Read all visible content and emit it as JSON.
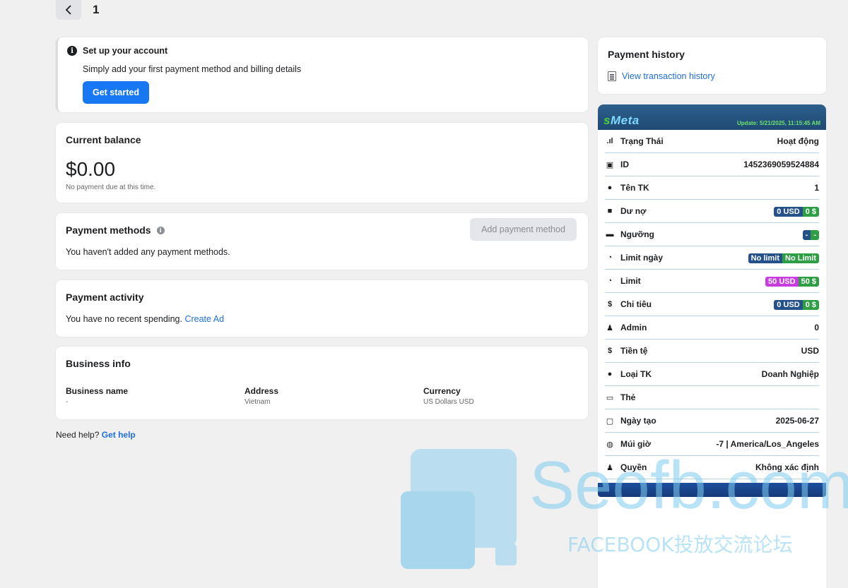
{
  "topbar": {
    "page": "1"
  },
  "setup": {
    "title": "Set up your account",
    "description": "Simply add your first payment method and billing details",
    "button": "Get started"
  },
  "balance": {
    "title": "Current balance",
    "amount": "$0.00",
    "note": "No payment due at this time."
  },
  "methods": {
    "title": "Payment methods",
    "button": "Add payment method",
    "empty": "You haven't added any payment methods."
  },
  "activity": {
    "title": "Payment activity",
    "text": "You have no recent spending.",
    "link": "Create Ad"
  },
  "business": {
    "title": "Business info",
    "columns": [
      {
        "label": "Business name",
        "value": "-"
      },
      {
        "label": "Address",
        "value": "Vietnam"
      },
      {
        "label": "Currency",
        "value": "US Dollars USD"
      }
    ]
  },
  "help": {
    "text": "Need help?",
    "link": "Get help"
  },
  "history": {
    "title": "Payment history",
    "link": "View transaction history"
  },
  "smeta": {
    "logo_s": "s",
    "logo_meta": "Meta",
    "update": "Update: 5/21/2025, 11:15:45 AM",
    "rows": [
      {
        "icon": "signal-icon",
        "label": "Trạng Thái",
        "value": "Hoạt động"
      },
      {
        "icon": "id-card-icon",
        "label": "ID",
        "value": "1452369059524884"
      },
      {
        "icon": "user-icon",
        "label": "Tên TK",
        "value": "1"
      },
      {
        "icon": "wallet-icon",
        "label": "Dư nợ",
        "pill": [
          "0 USD",
          "0 $"
        ]
      },
      {
        "icon": "bar-icon",
        "label": "Ngưỡng",
        "pill": [
          "-",
          "-"
        ]
      },
      {
        "icon": "gauge-icon",
        "label": "Limit ngày",
        "pill": [
          "No limit",
          "No Limit"
        ]
      },
      {
        "icon": "gauge-icon",
        "label": "Limit",
        "pill": [
          "50 USD",
          "50 $"
        ],
        "pill_color": "#c83ce0"
      },
      {
        "icon": "dollar-icon",
        "label": "Chi tiêu",
        "pill": [
          "0 USD",
          "0 $"
        ]
      },
      {
        "icon": "admin-icon",
        "label": "Admin",
        "value": "0"
      },
      {
        "icon": "dollar-icon",
        "label": "Tiền tệ",
        "value": "USD"
      },
      {
        "icon": "user-icon",
        "label": "Loại TK",
        "value": "Doanh Nghiệp"
      },
      {
        "icon": "card-icon",
        "label": "Thẻ",
        "value": ""
      },
      {
        "icon": "calendar-icon",
        "label": "Ngày tạo",
        "value": "2025-06-27"
      },
      {
        "icon": "globe-icon",
        "label": "Múi giờ",
        "value": "-7 | America/Los_Angeles"
      },
      {
        "icon": "admin-icon",
        "label": "Quyền",
        "value": "Không xác định"
      }
    ]
  },
  "watermark": {
    "text": "Seofb.com",
    "subtext": "FACEBOOK投放交流论坛"
  },
  "colors": {
    "primary": "#1877f2",
    "link": "#216fdb",
    "pill_blue": "#24518a",
    "pill_green": "#2e9e44",
    "pill_magenta": "#c83ce0"
  }
}
